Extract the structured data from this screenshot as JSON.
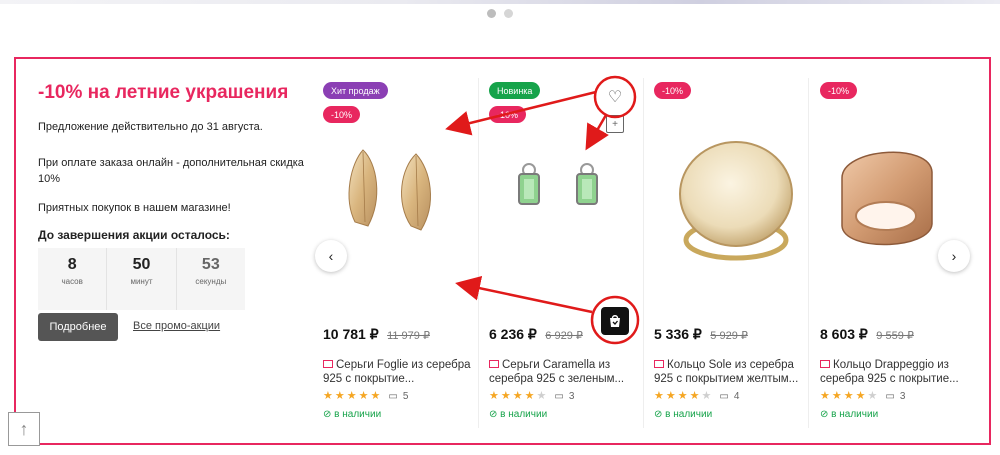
{
  "slider": {
    "dots": 2,
    "active_dot": 0
  },
  "promo": {
    "title": "-10% на летние украшения",
    "validity": "Предложение действительно до 31 августа.",
    "online_discount": "При оплате заказа онлайн - дополнительная скидка 10%",
    "wish": "Приятных покупок в нашем магазине!",
    "countdown_label": "До завершения акции осталось:",
    "countdown": [
      {
        "value": "8",
        "unit": "часов"
      },
      {
        "value": "50",
        "unit": "минут"
      },
      {
        "value": "53",
        "unit": "секунды"
      }
    ],
    "more_button": "Подробнее",
    "all_promos_link": "Все промо-акции"
  },
  "nav": {
    "prev_icon": "chevron-left-icon",
    "next_icon": "chevron-right-icon"
  },
  "products": [
    {
      "badges": [
        "Хит продаж",
        "-10%"
      ],
      "price": "10 781 ₽",
      "old_price": "11 979 ₽",
      "name": "Серьги Foglie из серебра 925 с покрытие...",
      "rating": 5,
      "reviews": "5",
      "stock": "в наличии"
    },
    {
      "badges": [
        "Новинка",
        "-10%"
      ],
      "price": "6 236 ₽",
      "old_price": "6 929 ₽",
      "name": "Серьги Caramella из серебра 925 с зеленым...",
      "rating": 4,
      "reviews": "3",
      "stock": "в наличии"
    },
    {
      "badges": [
        "-10%"
      ],
      "price": "5 336 ₽",
      "old_price": "5 929 ₽",
      "name": "Кольцо Sole из серебра 925 с покрытием желтым...",
      "rating": 4,
      "reviews": "4",
      "stock": "в наличии"
    },
    {
      "badges": [
        "-10%"
      ],
      "price": "8 603 ₽",
      "old_price": "9 559 ₽",
      "name": "Кольцо Drappeggio из серебра 925 с покрытие...",
      "rating": 4,
      "reviews": "3",
      "stock": "в наличии"
    }
  ],
  "colors": {
    "accent": "#e8275f",
    "hit_badge": "#8b3fb4",
    "new_badge": "#16a34a",
    "stock": "#16a34a",
    "star": "#f5a623",
    "annotation": "#e01a1a"
  }
}
